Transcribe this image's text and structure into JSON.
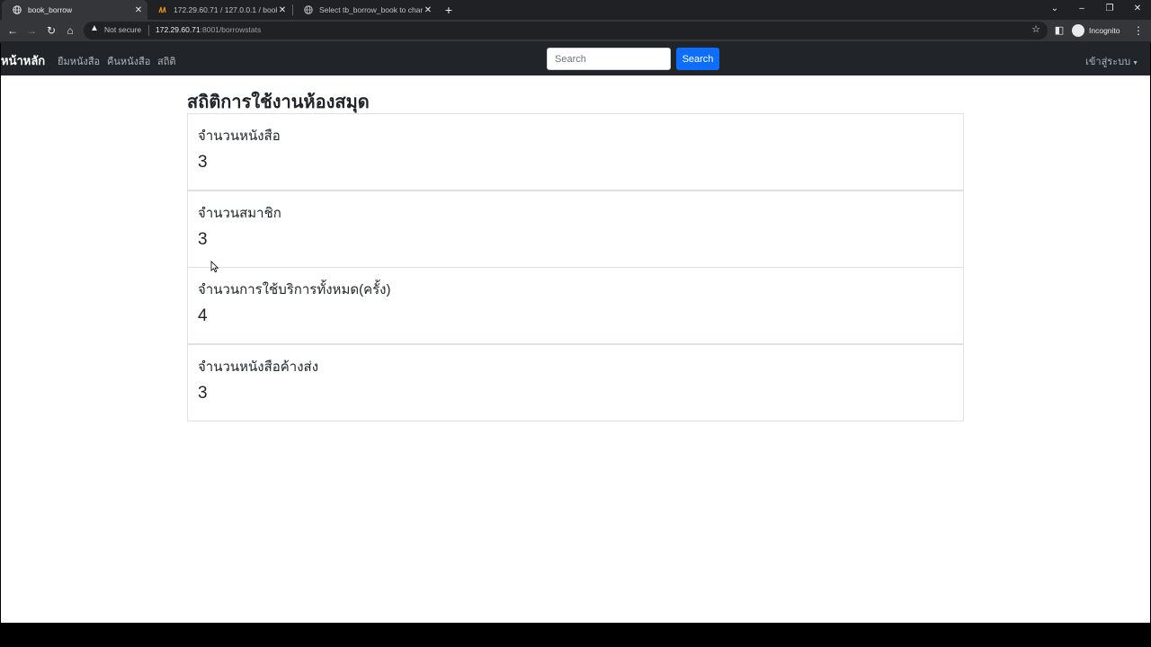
{
  "browser": {
    "tabs": [
      {
        "title": "book_borrow",
        "active": true
      },
      {
        "title": "172.29.60.71 / 127.0.0.1 / bookst",
        "active": false
      },
      {
        "title": "Select tb_borrow_book to chang",
        "active": false
      }
    ],
    "new_tab_icon": "plus-icon",
    "not_secure_label": "Not secure",
    "url_host": "172.29.60.71",
    "url_rest": ":8001/borrowstats",
    "profile_label": "Incognito"
  },
  "navbar": {
    "brand": "หน้าหลัก",
    "links": [
      "ยืมหนังสือ",
      "คืนหนังสือ",
      "สถิติ"
    ],
    "search_placeholder": "Search",
    "search_button": "Search",
    "login_label": "เข้าสู่ระบบ"
  },
  "page": {
    "title": "สถิติการใช้งานห้องสมุด",
    "cards": [
      {
        "label": "จำนวนหนังสือ",
        "value": "3"
      },
      {
        "label": "จำนวนสมาชิก",
        "value": "3"
      },
      {
        "label": "จำนวนการใช้บริการทั้งหมด(ครั้ง)",
        "value": "4"
      },
      {
        "label": "จำนวนหนังสือค้างส่ง",
        "value": "3"
      }
    ]
  },
  "colors": {
    "navbar_bg": "#212529",
    "primary": "#0d6efd",
    "chrome_dark": "#202124",
    "chrome_toolbar": "#35363a"
  }
}
